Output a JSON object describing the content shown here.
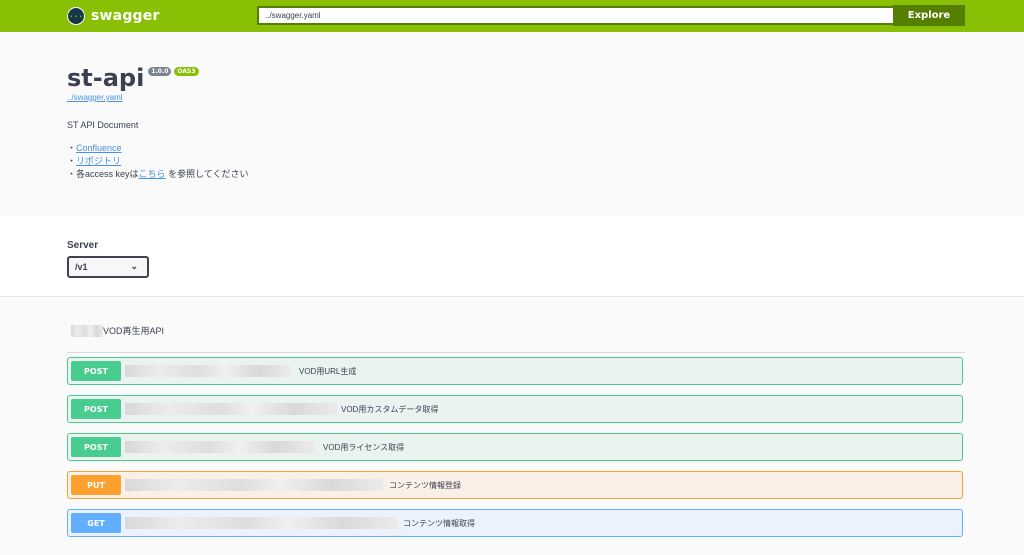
{
  "topbar": {
    "logo_icon": "{···}",
    "logo_text": "swagger",
    "url_value": "../swagger.yaml",
    "explore_label": "Explore"
  },
  "info": {
    "title": "st-api",
    "version_badge": "1.0.0",
    "oas_badge": "OAS3",
    "spec_link": "../swagger.yaml",
    "description": "ST API Document",
    "bullet": "・",
    "links": {
      "confluence": "Confluence",
      "repository": "リポジトリ",
      "access_prefix": "各access keyは",
      "access_link": "こちら",
      "access_suffix": " を参照してください"
    }
  },
  "server": {
    "label": "Server",
    "selected": "/v1",
    "chevron": "⌄"
  },
  "tag": {
    "name": "VOD再生用API"
  },
  "operations": [
    {
      "method": "POST",
      "summary": "VOD用URL生成"
    },
    {
      "method": "POST",
      "summary": "VOD用カスタムデータ取得"
    },
    {
      "method": "POST",
      "summary": "VOD用ライセンス取得"
    },
    {
      "method": "PUT",
      "summary": "コンテンツ情報登録"
    },
    {
      "method": "GET",
      "summary": "コンテンツ情報取得"
    }
  ],
  "colors": {
    "topbar": "#89bf04",
    "post": "#49cc90",
    "put": "#fca130",
    "get": "#61affe",
    "link": "#4990e2"
  }
}
